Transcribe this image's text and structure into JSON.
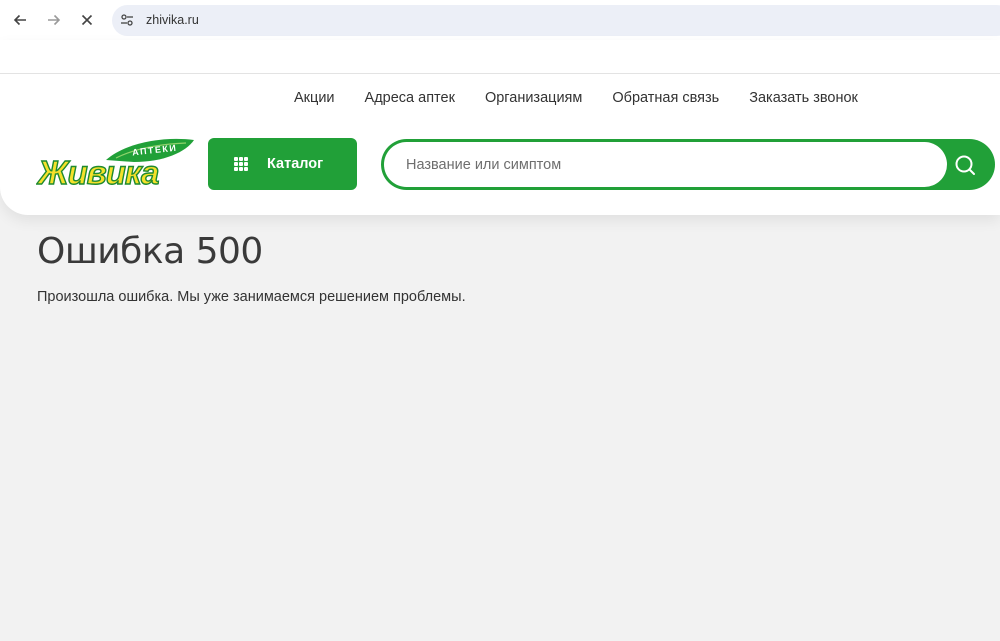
{
  "browser": {
    "url": "zhivika.ru"
  },
  "header": {
    "logo": {
      "brand": "Живика",
      "subtitle": "АПТЕКИ"
    },
    "topnav": [
      {
        "label": "Акции"
      },
      {
        "label": "Адреса аптек"
      },
      {
        "label": "Организациям"
      },
      {
        "label": "Обратная связь"
      },
      {
        "label": "Заказать звонок"
      }
    ],
    "catalog_label": "Каталог",
    "search": {
      "placeholder": "Название или симптом",
      "value": ""
    }
  },
  "content": {
    "title": "Ошибка 500",
    "message": "Произошла ошибка. Мы уже занимаемся решением проблемы."
  },
  "colors": {
    "brand_green": "#21a038",
    "logo_yellow": "#f5e12a",
    "page_bg": "#f2f2f2"
  },
  "icons": {
    "back": "arrow-left-icon",
    "forward": "arrow-right-icon",
    "stop": "close-icon",
    "site_info": "site-settings-icon",
    "catalog": "grid-icon",
    "search": "search-icon"
  }
}
